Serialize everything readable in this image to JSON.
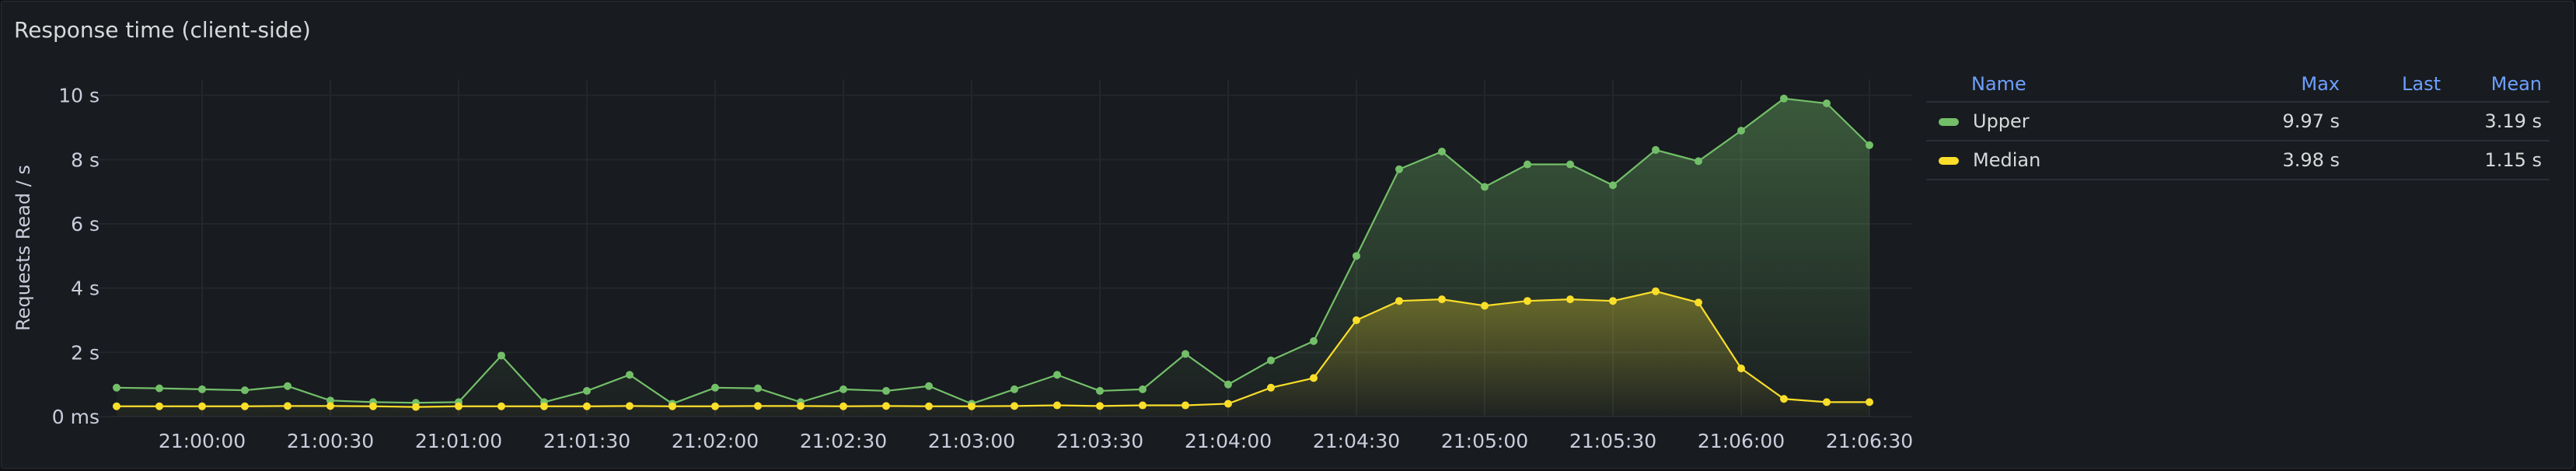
{
  "panel": {
    "title": "Response time (client-side)"
  },
  "colors": {
    "upper": "#73bf69",
    "median": "#fade2a",
    "legend_header": "#6e9fff",
    "grid": "#24262c",
    "text": "#ccccdc"
  },
  "legend": {
    "headers": {
      "name": "Name",
      "max": "Max",
      "last": "Last",
      "mean": "Mean"
    },
    "rows": [
      {
        "name": "Upper",
        "max": "9.97 s",
        "last": "",
        "mean": "3.19 s"
      },
      {
        "name": "Median",
        "max": "3.98 s",
        "last": "",
        "mean": "1.15 s"
      }
    ]
  },
  "chart_data": {
    "type": "line",
    "ylabel": "Requests Read / s",
    "ylim": [
      0,
      10.5
    ],
    "yticks": [
      {
        "value": 0,
        "label": "0 ms"
      },
      {
        "value": 2,
        "label": "2 s"
      },
      {
        "value": 4,
        "label": "4 s"
      },
      {
        "value": 6,
        "label": "6 s"
      },
      {
        "value": 8,
        "label": "8 s"
      },
      {
        "value": 10,
        "label": "10 s"
      }
    ],
    "xlim": [
      "20:59:40",
      "21:06:40"
    ],
    "xticks": [
      "21:00:00",
      "21:00:30",
      "21:01:00",
      "21:01:30",
      "21:02:00",
      "21:02:30",
      "21:03:00",
      "21:03:30",
      "21:04:00",
      "21:04:30",
      "21:05:00",
      "21:05:30",
      "21:06:00",
      "21:06:30"
    ],
    "grid": true,
    "legend_position": "right",
    "x": [
      "20:59:40",
      "20:59:50",
      "21:00:00",
      "21:00:10",
      "21:00:20",
      "21:00:30",
      "21:00:40",
      "21:00:50",
      "21:01:00",
      "21:01:10",
      "21:01:20",
      "21:01:30",
      "21:01:40",
      "21:01:50",
      "21:02:00",
      "21:02:10",
      "21:02:20",
      "21:02:30",
      "21:02:40",
      "21:02:50",
      "21:03:00",
      "21:03:10",
      "21:03:20",
      "21:03:30",
      "21:03:40",
      "21:03:50",
      "21:04:00",
      "21:04:10",
      "21:04:20",
      "21:04:30",
      "21:04:40",
      "21:04:50",
      "21:05:00",
      "21:05:10",
      "21:05:20",
      "21:05:30",
      "21:05:40",
      "21:05:50",
      "21:06:00",
      "21:06:10",
      "21:06:20",
      "21:06:30"
    ],
    "series": [
      {
        "name": "Upper",
        "values": [
          0.9,
          0.88,
          0.85,
          0.82,
          0.95,
          0.5,
          0.45,
          0.43,
          0.45,
          1.9,
          0.45,
          0.8,
          1.3,
          0.4,
          0.9,
          0.88,
          0.45,
          0.85,
          0.8,
          0.95,
          0.4,
          0.85,
          1.3,
          0.8,
          0.85,
          1.95,
          1.0,
          1.75,
          2.35,
          5.0,
          7.7,
          8.25,
          7.15,
          7.85,
          7.85,
          7.2,
          8.3,
          7.95,
          8.9,
          9.9,
          9.75,
          8.45
        ]
      },
      {
        "name": "Median",
        "values": [
          0.32,
          0.32,
          0.32,
          0.32,
          0.33,
          0.33,
          0.32,
          0.3,
          0.32,
          0.32,
          0.32,
          0.32,
          0.33,
          0.32,
          0.32,
          0.33,
          0.33,
          0.32,
          0.33,
          0.32,
          0.32,
          0.33,
          0.35,
          0.33,
          0.35,
          0.35,
          0.4,
          0.9,
          1.2,
          3.0,
          3.6,
          3.65,
          3.45,
          3.6,
          3.65,
          3.6,
          3.9,
          3.55,
          1.5,
          0.55,
          0.45,
          0.45
        ]
      }
    ]
  }
}
